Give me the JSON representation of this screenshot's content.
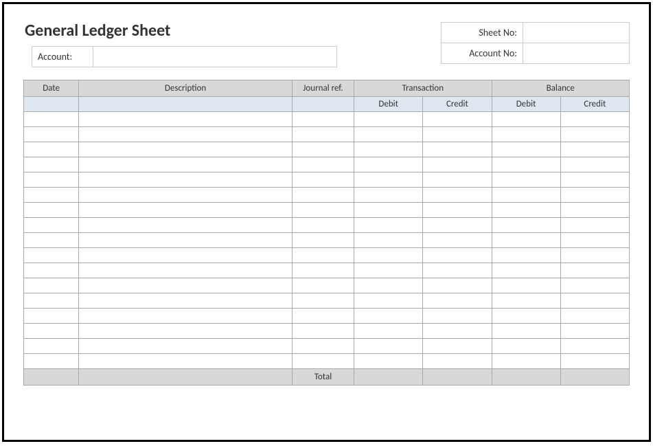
{
  "title": "General Ledger Sheet",
  "labels": {
    "account": "Account:",
    "sheet_no": "Sheet No:",
    "account_no": "Account No:"
  },
  "values": {
    "account": "",
    "sheet_no": "",
    "account_no": ""
  },
  "columns": {
    "date": "Date",
    "description": "Description",
    "journal_ref": "Journal ref.",
    "transaction": "Transaction",
    "balance": "Balance",
    "debit": "Debit",
    "credit": "Credit"
  },
  "total_label": "Total",
  "rows": [
    {
      "date": "",
      "description": "",
      "journal_ref": "",
      "t_debit": "",
      "t_credit": "",
      "b_debit": "",
      "b_credit": ""
    },
    {
      "date": "",
      "description": "",
      "journal_ref": "",
      "t_debit": "",
      "t_credit": "",
      "b_debit": "",
      "b_credit": ""
    },
    {
      "date": "",
      "description": "",
      "journal_ref": "",
      "t_debit": "",
      "t_credit": "",
      "b_debit": "",
      "b_credit": ""
    },
    {
      "date": "",
      "description": "",
      "journal_ref": "",
      "t_debit": "",
      "t_credit": "",
      "b_debit": "",
      "b_credit": ""
    },
    {
      "date": "",
      "description": "",
      "journal_ref": "",
      "t_debit": "",
      "t_credit": "",
      "b_debit": "",
      "b_credit": ""
    },
    {
      "date": "",
      "description": "",
      "journal_ref": "",
      "t_debit": "",
      "t_credit": "",
      "b_debit": "",
      "b_credit": ""
    },
    {
      "date": "",
      "description": "",
      "journal_ref": "",
      "t_debit": "",
      "t_credit": "",
      "b_debit": "",
      "b_credit": ""
    },
    {
      "date": "",
      "description": "",
      "journal_ref": "",
      "t_debit": "",
      "t_credit": "",
      "b_debit": "",
      "b_credit": ""
    },
    {
      "date": "",
      "description": "",
      "journal_ref": "",
      "t_debit": "",
      "t_credit": "",
      "b_debit": "",
      "b_credit": ""
    },
    {
      "date": "",
      "description": "",
      "journal_ref": "",
      "t_debit": "",
      "t_credit": "",
      "b_debit": "",
      "b_credit": ""
    },
    {
      "date": "",
      "description": "",
      "journal_ref": "",
      "t_debit": "",
      "t_credit": "",
      "b_debit": "",
      "b_credit": ""
    },
    {
      "date": "",
      "description": "",
      "journal_ref": "",
      "t_debit": "",
      "t_credit": "",
      "b_debit": "",
      "b_credit": ""
    },
    {
      "date": "",
      "description": "",
      "journal_ref": "",
      "t_debit": "",
      "t_credit": "",
      "b_debit": "",
      "b_credit": ""
    },
    {
      "date": "",
      "description": "",
      "journal_ref": "",
      "t_debit": "",
      "t_credit": "",
      "b_debit": "",
      "b_credit": ""
    },
    {
      "date": "",
      "description": "",
      "journal_ref": "",
      "t_debit": "",
      "t_credit": "",
      "b_debit": "",
      "b_credit": ""
    },
    {
      "date": "",
      "description": "",
      "journal_ref": "",
      "t_debit": "",
      "t_credit": "",
      "b_debit": "",
      "b_credit": ""
    },
    {
      "date": "",
      "description": "",
      "journal_ref": "",
      "t_debit": "",
      "t_credit": "",
      "b_debit": "",
      "b_credit": ""
    }
  ],
  "totals": {
    "t_debit": "",
    "t_credit": "",
    "b_debit": "",
    "b_credit": ""
  }
}
